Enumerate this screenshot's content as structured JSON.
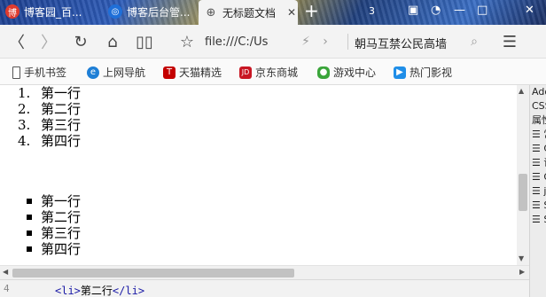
{
  "tabs": [
    {
      "label": "博客园_百...",
      "active": false
    },
    {
      "label": "博客后台管...",
      "active": false
    },
    {
      "label": "无标题文档",
      "active": true
    }
  ],
  "tab_count": "3",
  "address": {
    "url": "file:///C:/Us",
    "search_text": "朝马互禁公民高墙"
  },
  "bookmarks": [
    {
      "label": "手机书签",
      "icon": "phone-icon"
    },
    {
      "label": "上网导航",
      "icon": "ie-icon"
    },
    {
      "label": "天猫精选",
      "icon": "tmall-icon"
    },
    {
      "label": "京东商城",
      "icon": "jd-icon"
    },
    {
      "label": "游戏中心",
      "icon": "gamepad-icon"
    },
    {
      "label": "热门影视",
      "icon": "play-icon"
    }
  ],
  "ordered_list": [
    {
      "num": "1.",
      "text": "第一行"
    },
    {
      "num": "2.",
      "text": "第二行"
    },
    {
      "num": "3.",
      "text": "第三行"
    },
    {
      "num": "4.",
      "text": "第四行"
    }
  ],
  "unordered_list": [
    "第一行",
    "第二行",
    "第三行",
    "第四行"
  ],
  "devtools": [
    "Ado",
    "CSS",
    "属性",
    "☰ 常",
    "☰ C",
    "☰ 语",
    "☰ G",
    "☰ j",
    "☰ S",
    "☰ S"
  ],
  "code_line": {
    "line_number": "4",
    "open_tag": "<li>",
    "text": "第二行",
    "close_tag": "</li>"
  }
}
